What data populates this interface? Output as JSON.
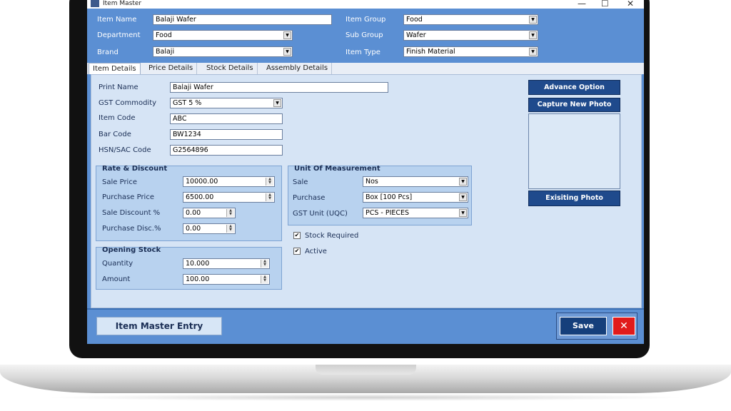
{
  "window": {
    "title": "Item Master",
    "minimize": "—",
    "maximize": "☐",
    "close": "✕"
  },
  "header": {
    "item_name": {
      "label": "Item Name",
      "value": "Balaji Wafer"
    },
    "department": {
      "label": "Department",
      "value": "Food"
    },
    "brand": {
      "label": "Brand",
      "value": "Balaji"
    },
    "item_group": {
      "label": "Item Group",
      "value": "Food"
    },
    "sub_group": {
      "label": "Sub Group",
      "value": "Wafer"
    },
    "item_type": {
      "label": "Item Type",
      "value": "Finish Material"
    }
  },
  "tabs": [
    "Item Details",
    "Price Details",
    "Stock Details",
    "Assembly Details"
  ],
  "details": {
    "print_name": {
      "label": "Print Name",
      "value": "Balaji Wafer"
    },
    "gst_commodity": {
      "label": "GST Commodity",
      "value": "GST 5 %"
    },
    "item_code": {
      "label": "Item Code",
      "value": "ABC"
    },
    "bar_code": {
      "label": "Bar Code",
      "value": "BW1234"
    },
    "hsn_sac": {
      "label": "HSN/SAC Code",
      "value": "G2564896"
    }
  },
  "rate_discount": {
    "title": "Rate & Discount",
    "sale_price": {
      "label": "Sale Price",
      "value": "10000.00"
    },
    "purchase_price": {
      "label": "Purchase Price",
      "value": "6500.00"
    },
    "sale_discount": {
      "label": "Sale Discount %",
      "value": "0.00"
    },
    "purchase_disc": {
      "label": "Purchase Disc.%",
      "value": "0.00"
    }
  },
  "opening_stock": {
    "title": "Opening Stock",
    "quantity": {
      "label": "Quantity",
      "value": "10.000"
    },
    "amount": {
      "label": "Amount",
      "value": "100.00"
    }
  },
  "uom": {
    "title": "Unit Of Measurement",
    "sale": {
      "label": "Sale",
      "value": "Nos"
    },
    "purchase": {
      "label": "Purchase",
      "value": "Box [100 Pcs]"
    },
    "gst_unit": {
      "label": "GST Unit (UQC)",
      "value": "PCS - PIECES"
    }
  },
  "checks": {
    "stock_required": {
      "label": "Stock Required",
      "checked": true,
      "mark": "✔"
    },
    "active": {
      "label": "Active",
      "checked": true,
      "mark": "✔"
    }
  },
  "photo": {
    "advance_option": "Advance Option",
    "capture_new_photo": "Capture New Photo",
    "existing_photo": "Exisiting Photo"
  },
  "footer": {
    "entry_title": "Item Master Entry",
    "save": "Save",
    "close": "✕"
  }
}
